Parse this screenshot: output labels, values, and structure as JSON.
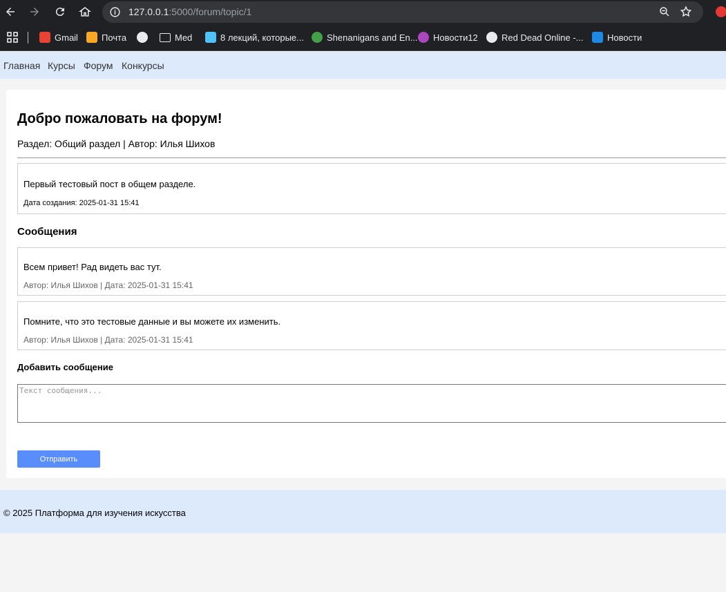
{
  "browser": {
    "url_host": "127.0.0.1",
    "url_path": ":5000/forum/topic/1",
    "bookmarks": [
      {
        "label": "Gmail",
        "icon": "gmail-icon",
        "color": "#ea4335"
      },
      {
        "label": "Почта",
        "icon": "mail-icon",
        "color": "#f9a825"
      },
      {
        "label": "",
        "icon": "globe-icon",
        "color": "#e8eaed"
      },
      {
        "label": "Med",
        "icon": "folder-icon",
        "color": "#e8eaed"
      },
      {
        "label": "8 лекций, которые...",
        "icon": "lecture-icon",
        "color": "#4fc3f7"
      },
      {
        "label": "Shenanigans and En...",
        "icon": "smiley-icon",
        "color": "#43a047"
      },
      {
        "label": "Новости12",
        "icon": "colorwheel-icon",
        "color": "#ab47bc"
      },
      {
        "label": "Red Dead Online -...",
        "icon": "rdo-icon",
        "color": "#e8eaed"
      },
      {
        "label": "Новости",
        "icon": "news-icon",
        "color": "#1e88e5"
      }
    ]
  },
  "nav": {
    "links": [
      "Главная",
      "Курсы",
      "Форум",
      "Конкурсы"
    ]
  },
  "topic": {
    "title": "Добро пожаловать на форум!",
    "meta": "Раздел: Общий раздел | Автор: Илья Шихов",
    "post_text": "Первый тестовый пост в общем разделе.",
    "post_date": "Дата создания: 2025-01-31 15:41"
  },
  "messages": {
    "heading": "Сообщения",
    "items": [
      {
        "text": "Всем привет! Рад видеть вас тут.",
        "meta": "Автор: Илья Шихов | Дата: 2025-01-31 15:41"
      },
      {
        "text": "Помните, что это тестовые данные и вы можете их изменить.",
        "meta": "Автор: Илья Шихов | Дата: 2025-01-31 15:41"
      }
    ]
  },
  "compose": {
    "heading": "Добавить сообщение",
    "placeholder": "Текст сообщения...",
    "submit_label": "Отправить"
  },
  "footer": {
    "text": "© 2025 Платформа для изучения искусства"
  },
  "colors": {
    "nav_bg": "#ddeafc",
    "button_bg": "#5a8dfc",
    "chrome_bg": "#202124"
  }
}
